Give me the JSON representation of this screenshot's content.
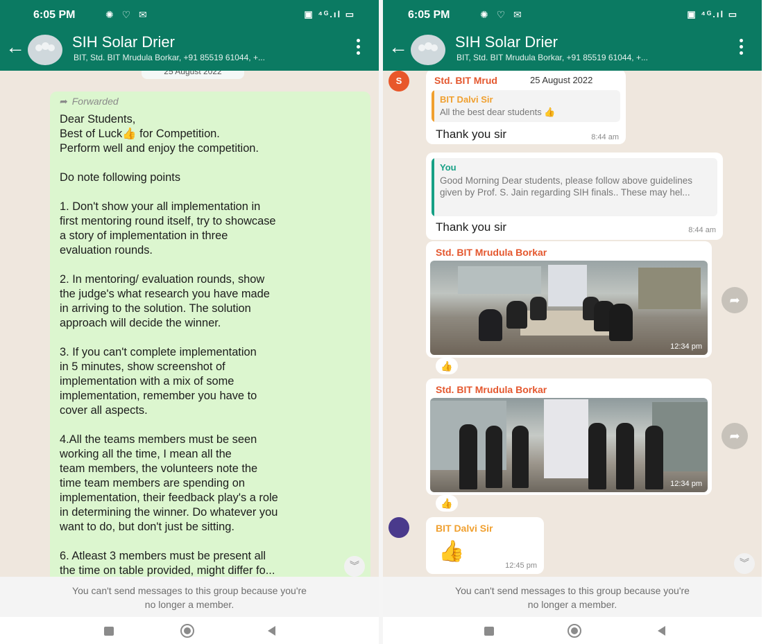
{
  "status": {
    "time": "6:05 PM",
    "left_icons": "✺ ♡ ✉",
    "right_icons": "▣ ⁴ᴳ.ıl ▭"
  },
  "chat": {
    "title": "SIH Solar Drier",
    "subtitle": "BIT, Std. BIT Mrudula Borkar, +91 85519 61044, +..."
  },
  "left": {
    "date_chip": "25 August 2022",
    "forwarded_label": "Forwarded",
    "message": "Dear Students,\nBest of Luck👍 for Competition.\nPerform well and enjoy the competition.\n\nDo note following points\n\n1. Don't show your all implementation in\nfirst mentoring round itself, try to showcase\na story of implementation in three\nevaluation rounds.\n\n2. In mentoring/ evaluation rounds, show\nthe judge's what research you have made\nin arriving to the solution. The solution\napproach will decide the winner.\n\n3. If you can't complete implementation\nin 5 minutes, show screenshot of\nimplementation with a mix of some\nimplementation, remember you have to\ncover all aspects.\n\n4.All the teams members must be seen\nworking all the time, I mean all the\nteam members, the volunteers note the\ntime team members are spending on\nimplementation, their feedback play's a role\nin determining the winner. Do whatever you\nwant to do, but don't just be sitting.\n\n6. Atleast 3 members must be present all\nthe time on table provided, might differ fo..."
  },
  "right": {
    "avatar_letter": "S",
    "msg1": {
      "sender": "Std. BIT Mrud",
      "date": "25 August 2022",
      "quote_name": "BIT Dalvi Sir",
      "quote_text": "All the best dear students 👍",
      "text": "Thank you sir",
      "time": "8:44 am"
    },
    "msg2": {
      "quote_name": "You",
      "quote_text": "Good Morning Dear students, please follow above guidelines given by Prof. S. Jain regarding SIH finals.. These may hel...",
      "text": "Thank you sir",
      "time": "8:44 am"
    },
    "photo1": {
      "sender": "Std. BIT Mrudula Borkar",
      "time": "12:34 pm",
      "reaction": "👍"
    },
    "photo2": {
      "sender": "Std. BIT Mrudula Borkar",
      "time": "12:34 pm",
      "reaction": "👍"
    },
    "msg3": {
      "sender": "BIT Dalvi Sir",
      "sticker": "👍",
      "time": "12:45 pm"
    }
  },
  "footer": {
    "notice_line1": "You can't send messages to this group because you're",
    "notice_line2": "no longer a member."
  },
  "icons": {
    "back": "←",
    "forward": "➦",
    "share": "➦",
    "scroll_down": "︾"
  },
  "colors": {
    "header": "#0b7a62",
    "chat_background": "#efe7de",
    "outgoing_bubble": "#dcf6cf",
    "incoming_bubble": "#ffffff",
    "sender_orange": "#e4572e",
    "quote_bar_orange": "#f0a030",
    "quote_bar_teal": "#16a085",
    "avatar_orange": "#e8572a"
  }
}
